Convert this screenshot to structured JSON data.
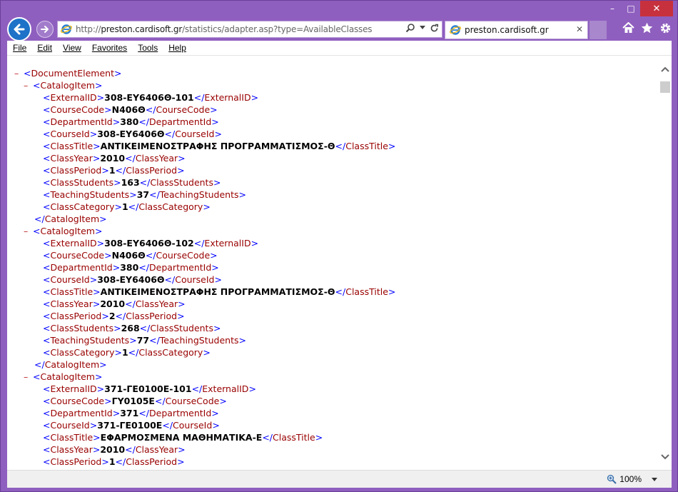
{
  "caption": {
    "minimize": "–",
    "maximize": "□",
    "close": "✕"
  },
  "address": {
    "scheme": "http://",
    "host": "preston.cardisoft.gr",
    "path": "/statistics/adapter.asp?type=AvailableClasses"
  },
  "tab": {
    "title": "preston.cardisoft.gr",
    "close": "✕"
  },
  "menu": [
    "File",
    "Edit",
    "View",
    "Favorites",
    "Tools",
    "Help"
  ],
  "root_tag": "DocumentElement",
  "item_tag": "CatalogItem",
  "items": [
    {
      "ExternalID": "308-ΕΥ6406Θ-101",
      "CourseCode": "Ν406Θ",
      "DepartmentId": "380",
      "CourseId": "308-ΕΥ6406Θ",
      "ClassTitle": "ΑΝΤΙΚΕΙΜΕΝΟΣΤΡΑΦΗΣ ΠΡΟΓΡΑΜΜΑΤΙΣΜΟΣ-Θ",
      "ClassYear": "2010",
      "ClassPeriod": "1",
      "ClassStudents": "163",
      "TeachingStudents": "37",
      "ClassCategory": "1"
    },
    {
      "ExternalID": "308-ΕΥ6406Θ-102",
      "CourseCode": "Ν406Θ",
      "DepartmentId": "380",
      "CourseId": "308-ΕΥ6406Θ",
      "ClassTitle": "ΑΝΤΙΚΕΙΜΕΝΟΣΤΡΑΦΗΣ ΠΡΟΓΡΑΜΜΑΤΙΣΜΟΣ-Θ",
      "ClassYear": "2010",
      "ClassPeriod": "2",
      "ClassStudents": "268",
      "TeachingStudents": "77",
      "ClassCategory": "1"
    },
    {
      "ExternalID": "371-ΓΕ0100Ε-101",
      "CourseCode": "ΓΥ0105Ε",
      "DepartmentId": "371",
      "CourseId": "371-ΓΕ0100Ε",
      "ClassTitle": "ΕΦΑΡΜΟΣΜΕΝΑ ΜΑΘΗΜΑΤΙΚΑ-Ε",
      "ClassYear": "2010",
      "ClassPeriod": "1"
    }
  ],
  "status": {
    "zoom": "100%"
  }
}
